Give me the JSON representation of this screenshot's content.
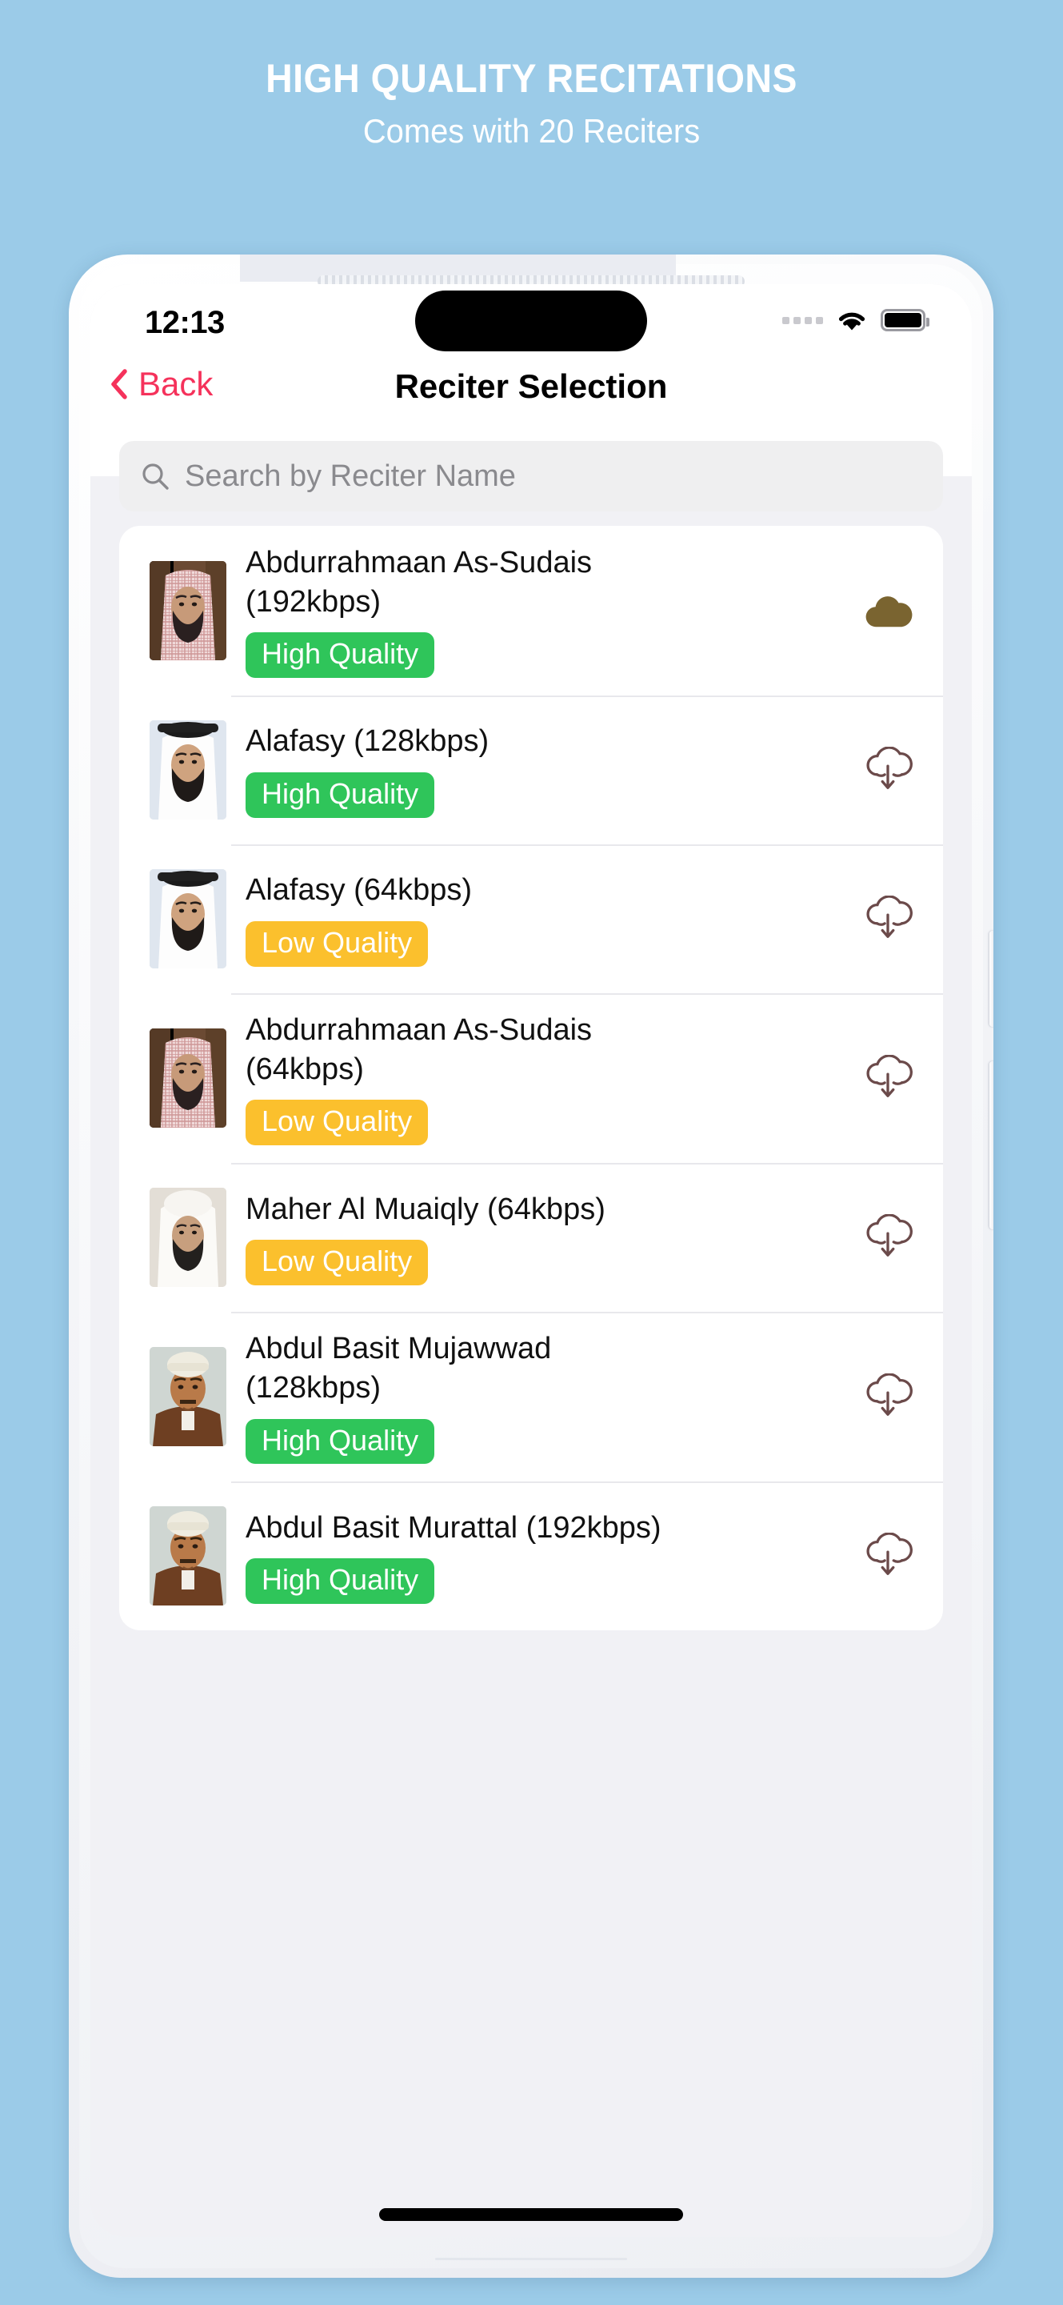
{
  "promo": {
    "title": "HIGH QUALITY RECITATIONS",
    "subtitle": "Comes with 20 Reciters",
    "background_color": "#9BCBE8",
    "text_color": "#FFFFFF"
  },
  "status_bar": {
    "time": "12:13",
    "signal_icon": "signal-dots-icon",
    "wifi_icon": "wifi-icon",
    "battery_icon": "battery-full-icon"
  },
  "nav": {
    "back_label": "Back",
    "back_icon": "chevron-left-icon",
    "title": "Reciter Selection",
    "accent_color": "#F5325B"
  },
  "search": {
    "placeholder": "Search by Reciter Name",
    "value": "",
    "icon": "search-icon"
  },
  "quality_colors": {
    "high": "#2FC55A",
    "low": "#FBC02D",
    "downloaded_cloud": "#7A6430",
    "download_cloud": "#6B4A4A"
  },
  "reciters": [
    {
      "name": "Abdurrahmaan As-Sudais (192kbps)",
      "badge": "High Quality",
      "badge_type": "high",
      "download_state": "downloaded",
      "download_icon": "cloud-filled-icon",
      "avatar": "sudais-portrait"
    },
    {
      "name": "Alafasy (128kbps)",
      "badge": "High Quality",
      "badge_type": "high",
      "download_state": "not-downloaded",
      "download_icon": "cloud-download-icon",
      "avatar": "alafasy-portrait"
    },
    {
      "name": "Alafasy (64kbps)",
      "badge": "Low Quality",
      "badge_type": "low",
      "download_state": "not-downloaded",
      "download_icon": "cloud-download-icon",
      "avatar": "alafasy-portrait"
    },
    {
      "name": "Abdurrahmaan As-Sudais (64kbps)",
      "badge": "Low Quality",
      "badge_type": "low",
      "download_state": "not-downloaded",
      "download_icon": "cloud-download-icon",
      "avatar": "sudais-portrait"
    },
    {
      "name": "Maher Al Muaiqly (64kbps)",
      "badge": "Low Quality",
      "badge_type": "low",
      "download_state": "not-downloaded",
      "download_icon": "cloud-download-icon",
      "avatar": "muaiqly-portrait"
    },
    {
      "name": "Abdul Basit Mujawwad (128kbps)",
      "badge": "High Quality",
      "badge_type": "high",
      "download_state": "not-downloaded",
      "download_icon": "cloud-download-icon",
      "avatar": "basit-portrait"
    },
    {
      "name": "Abdul Basit Murattal (192kbps)",
      "badge": "High Quality",
      "badge_type": "high",
      "download_state": "not-downloaded",
      "download_icon": "cloud-download-icon",
      "avatar": "basit-portrait"
    }
  ]
}
